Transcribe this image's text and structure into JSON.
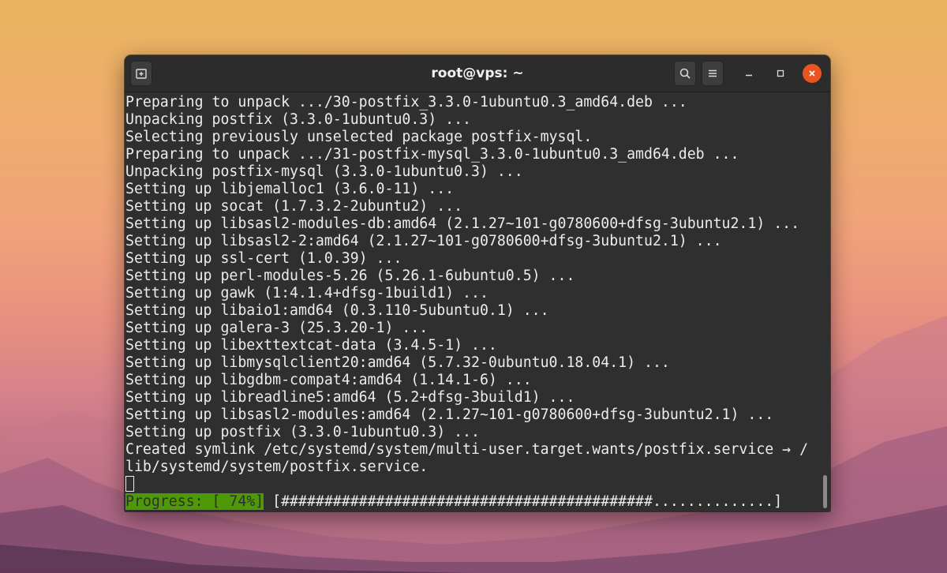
{
  "window": {
    "title": "root@vps: ~",
    "icons": {
      "new_tab": "new-tab-icon",
      "search": "search-icon",
      "menu": "hamburger-menu-icon",
      "minimize": "minimize-icon",
      "maximize": "maximize-icon",
      "close": "close-icon"
    }
  },
  "colors": {
    "terminal_bg": "#2f2f2f",
    "terminal_fg": "#ececec",
    "close_button": "#e95420",
    "progress_bg": "#4e9a06"
  },
  "terminal": {
    "lines": [
      "Preparing to unpack .../30-postfix_3.3.0-1ubuntu0.3_amd64.deb ...",
      "Unpacking postfix (3.3.0-1ubuntu0.3) ...",
      "Selecting previously unselected package postfix-mysql.",
      "Preparing to unpack .../31-postfix-mysql_3.3.0-1ubuntu0.3_amd64.deb ...",
      "Unpacking postfix-mysql (3.3.0-1ubuntu0.3) ...",
      "Setting up libjemalloc1 (3.6.0-11) ...",
      "Setting up socat (1.7.3.2-2ubuntu2) ...",
      "Setting up libsasl2-modules-db:amd64 (2.1.27~101-g0780600+dfsg-3ubuntu2.1) ...",
      "Setting up libsasl2-2:amd64 (2.1.27~101-g0780600+dfsg-3ubuntu2.1) ...",
      "Setting up ssl-cert (1.0.39) ...",
      "Setting up perl-modules-5.26 (5.26.1-6ubuntu0.5) ...",
      "Setting up gawk (1:4.1.4+dfsg-1build1) ...",
      "Setting up libaio1:amd64 (0.3.110-5ubuntu0.1) ...",
      "Setting up galera-3 (25.3.20-1) ...",
      "Setting up libexttextcat-data (3.4.5-1) ...",
      "Setting up libmysqlclient20:amd64 (5.7.32-0ubuntu0.18.04.1) ...",
      "Setting up libgdbm-compat4:amd64 (1.14.1-6) ...",
      "Setting up libreadline5:amd64 (5.2+dfsg-3build1) ...",
      "Setting up libsasl2-modules:amd64 (2.1.27~101-g0780600+dfsg-3ubuntu2.1) ...",
      "Setting up postfix (3.3.0-1ubuntu0.3) ...",
      "Created symlink /etc/systemd/system/multi-user.target.wants/postfix.service → /",
      "lib/systemd/system/postfix.service."
    ],
    "progress": {
      "label": "Progress: [ 74%]",
      "bar": " [###########################################..............]",
      "percent": 74
    }
  }
}
